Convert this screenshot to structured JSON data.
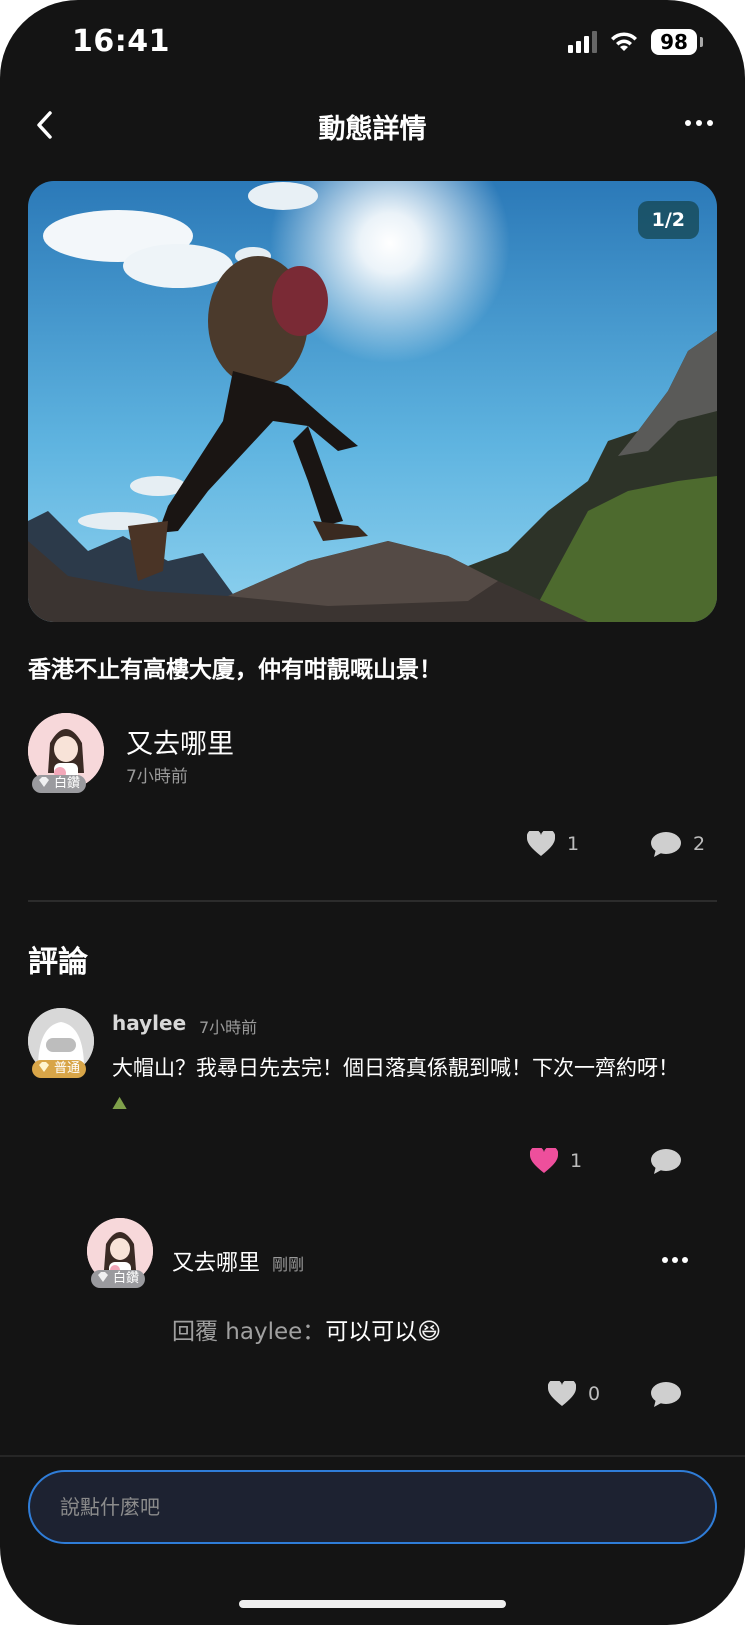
{
  "status_bar": {
    "time": "16:41",
    "battery": "98"
  },
  "header": {
    "title": "動態詳情"
  },
  "post": {
    "page_indicator": "1/2",
    "text": "香港不止有高樓大廈，仲有咁靚嘅山景！",
    "author": {
      "name": "又去哪里",
      "time": "7小時前",
      "badge": "白鑽"
    },
    "likes": "1",
    "comments": "2"
  },
  "comments_section": {
    "title": "評論",
    "comment": {
      "user": "haylee",
      "time": "7小時前",
      "badge": "普通",
      "text": "大帽山？我尋日先去完！個日落真係靚到喊！下次一齊約呀！",
      "emoji": "⛰",
      "likes": "1",
      "heart_color": "#ee4f9c"
    },
    "reply": {
      "user": "又去哪里",
      "time": "剛剛",
      "badge": "白鑽",
      "prefix": "回覆 haylee：",
      "text": "可以可以",
      "emoji": "😆",
      "likes": "0"
    }
  },
  "input": {
    "placeholder": "說點什麼吧"
  },
  "colors": {
    "background": "#141414",
    "accent": "#2f7dd8"
  }
}
